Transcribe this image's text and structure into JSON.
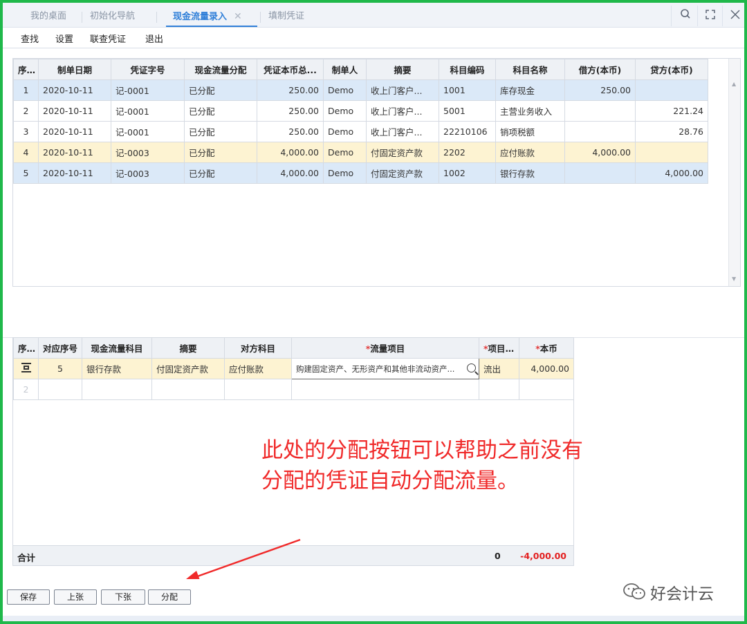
{
  "tabs": [
    {
      "label": "我的桌面"
    },
    {
      "label": "初始化导航"
    },
    {
      "label": "现金流量录入"
    },
    {
      "label": "填制凭证"
    }
  ],
  "toolbar": {
    "find": "查找",
    "settings": "设置",
    "view_voucher": "联查凭证",
    "exit": "退出"
  },
  "upper_grid": {
    "headers": [
      "序号",
      "制单日期",
      "凭证字号",
      "现金流量分配",
      "凭证本币总...",
      "制单人",
      "摘要",
      "科目编码",
      "科目名称",
      "借方(本币)",
      "贷方(本币)"
    ],
    "rows": [
      [
        "1",
        "2020-10-11",
        "记-0001",
        "已分配",
        "250.00",
        "Demo",
        "收上门客户...",
        "1001",
        "库存现金",
        "250.00",
        ""
      ],
      [
        "2",
        "2020-10-11",
        "记-0001",
        "已分配",
        "250.00",
        "Demo",
        "收上门客户...",
        "5001",
        "主营业务收入",
        "",
        "221.24"
      ],
      [
        "3",
        "2020-10-11",
        "记-0001",
        "已分配",
        "250.00",
        "Demo",
        "收上门客户...",
        "22210106",
        "销项税额",
        "",
        "28.76"
      ],
      [
        "4",
        "2020-10-11",
        "记-0003",
        "已分配",
        "4,000.00",
        "Demo",
        "付固定资产款",
        "2202",
        "应付账款",
        "4,000.00",
        ""
      ],
      [
        "5",
        "2020-10-11",
        "记-0003",
        "已分配",
        "4,000.00",
        "Demo",
        "付固定资产款",
        "1002",
        "银行存款",
        "",
        "4,000.00"
      ]
    ]
  },
  "lower_grid": {
    "headers": [
      "序号",
      "对应序号",
      "现金流量科目",
      "摘要",
      "对方科目",
      "流量项目",
      "项目...",
      "本币"
    ],
    "row1": {
      "seq": "5",
      "cash_subject": "银行存款",
      "summary": "付固定资产款",
      "counter_subject": "应付账款",
      "flow_item": "购建固定资产、无形资产和其他非流动资产...",
      "direction": "流出",
      "amount": "4,000.00"
    },
    "row2_index": "2",
    "total_label": "合计",
    "total_qty": "0",
    "total_amount": "-4,000.00"
  },
  "annotation": {
    "line1": "此处的分配按钮可以帮助之前没有",
    "line2": "分配的凭证自动分配流量。"
  },
  "buttons": {
    "save": "保存",
    "prev": "上张",
    "next": "下张",
    "allocate": "分配"
  },
  "brand": {
    "text": "好会计云"
  },
  "colors": {
    "frame": "#1fb84a",
    "accent": "#2f7fd8",
    "annotation": "#f02a2a",
    "negative": "#e32020"
  }
}
